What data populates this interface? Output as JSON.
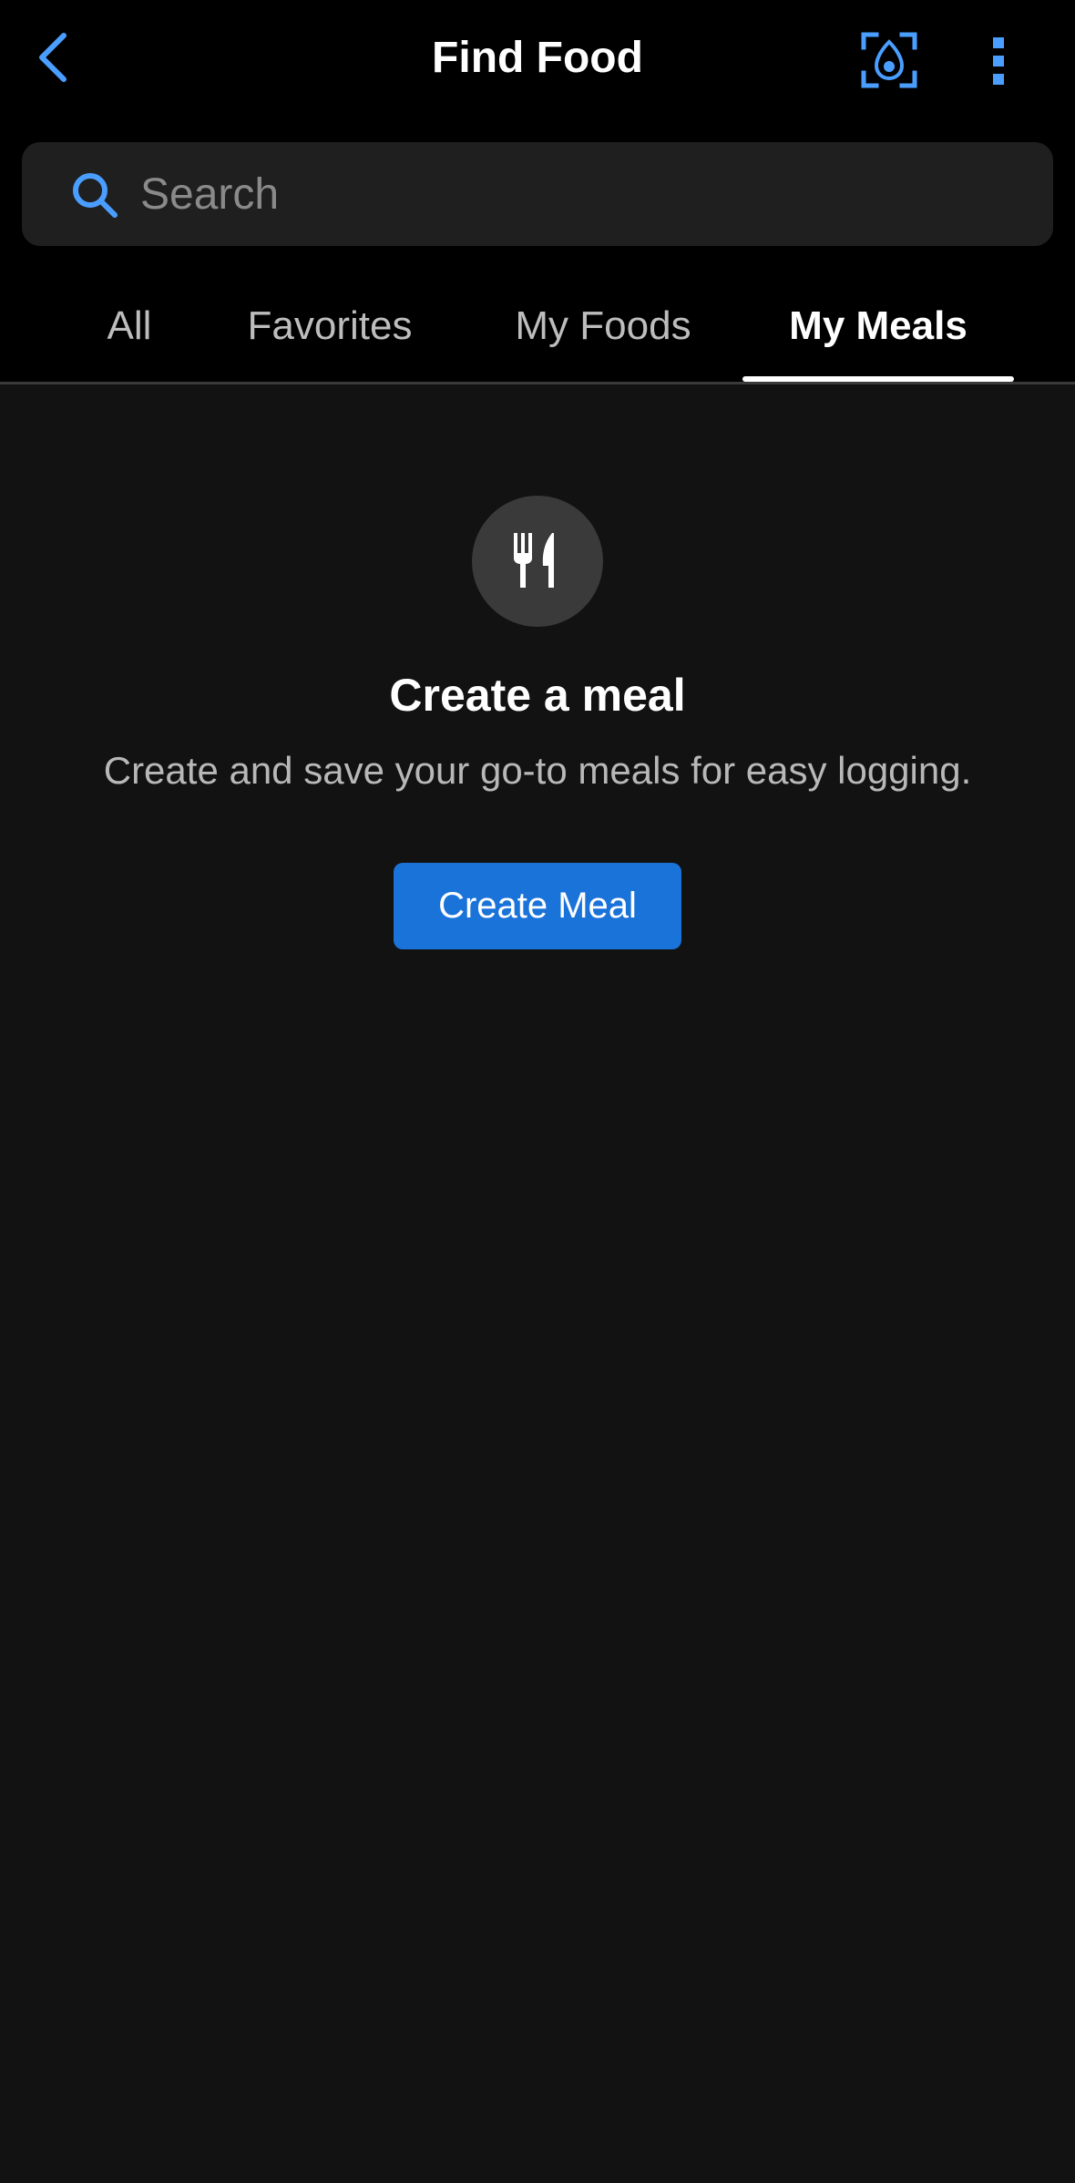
{
  "header": {
    "title": "Find Food",
    "back_icon": "chevron-left-icon",
    "scan_icon": "avocado-scan-icon",
    "more_icon": "vertical-dots-icon"
  },
  "search": {
    "placeholder": "Search",
    "value": ""
  },
  "tabs": [
    {
      "label": "All",
      "active": false
    },
    {
      "label": "Favorites",
      "active": false
    },
    {
      "label": "My Foods",
      "active": false
    },
    {
      "label": "My Meals",
      "active": true
    }
  ],
  "empty_state": {
    "icon": "fork-knife-icon",
    "title": "Create a meal",
    "description": "Create and save your go-to meals for easy logging.",
    "button_label": "Create Meal"
  },
  "colors": {
    "accent": "#4a9eff",
    "primary_button": "#1a73d9",
    "background": "#121212",
    "header_background": "#000000"
  }
}
